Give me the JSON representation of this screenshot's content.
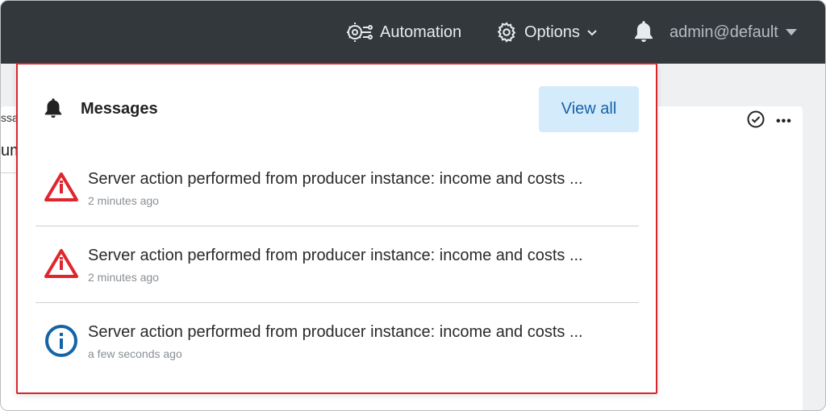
{
  "topbar": {
    "automation_label": "Automation",
    "options_label": "Options",
    "user_label": "admin@default"
  },
  "background": {
    "fragment_1": "ssa",
    "fragment_2": "um"
  },
  "popup": {
    "title": "Messages",
    "view_all_label": "View all",
    "messages": [
      {
        "type": "warning",
        "text": "Server action performed from producer instance: income and costs ...",
        "time": "2 minutes ago"
      },
      {
        "type": "warning",
        "text": "Server action performed from producer instance: income and costs ...",
        "time": "2 minutes ago"
      },
      {
        "type": "info",
        "text": "Server action performed from producer instance: income and costs ...",
        "time": "a few seconds ago"
      }
    ]
  },
  "colors": {
    "topbar_bg": "#33383d",
    "accent_blue": "#1463a8",
    "warning_red": "#e0262d",
    "popup_border": "#d9262c"
  },
  "icons": [
    "automation-icon",
    "gear-icon",
    "chevron-down-icon",
    "bell-icon",
    "caret-down-icon",
    "check-circle-icon",
    "more-icon",
    "warning-icon",
    "info-icon"
  ]
}
